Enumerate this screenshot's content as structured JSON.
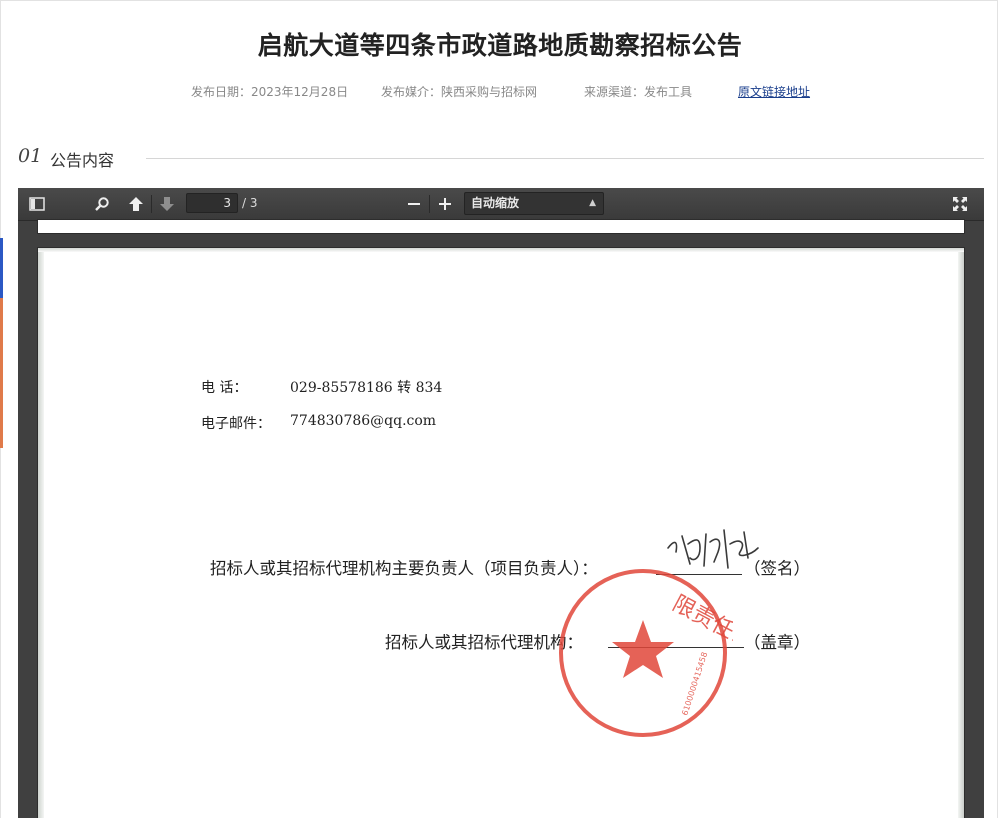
{
  "header": {
    "title": "启航大道等四条市政道路地质勘察招标公告",
    "publish_date": "发布日期：2023年12月28日",
    "media": "发布媒介：陕西采购与招标网",
    "source": "来源渠道：发布工具",
    "original_link": "原文链接地址"
  },
  "section": {
    "number": "01",
    "label": "公告内容"
  },
  "pdf_viewer": {
    "current_page": "3",
    "page_count": "/ 3",
    "zoom_label": "自动缩放",
    "icons": [
      "sidebar-toggle-icon",
      "search-icon",
      "previous-page-icon",
      "next-page-icon",
      "zoom-out-icon",
      "zoom-in-icon",
      "fullscreen-icon"
    ]
  },
  "document": {
    "phone_label": "电      话：",
    "phone_value": "029-85578186 转 834",
    "email_label": "电子邮件：",
    "email_value": "774830786@qq.com",
    "signer_label": "招标人或其招标代理机构主要负责人（项目负责人）：",
    "signer_suffix": "（签名）",
    "agency_label": "招标人或其招标代理机构：",
    "agency_suffix": "（盖章）",
    "seal_text": "限责任公司",
    "seal_number": "6100000415458"
  },
  "colors": {
    "title": "#222222",
    "link": "#1a3e8c",
    "toolbar": "#404040",
    "seal": "#e0463a"
  }
}
